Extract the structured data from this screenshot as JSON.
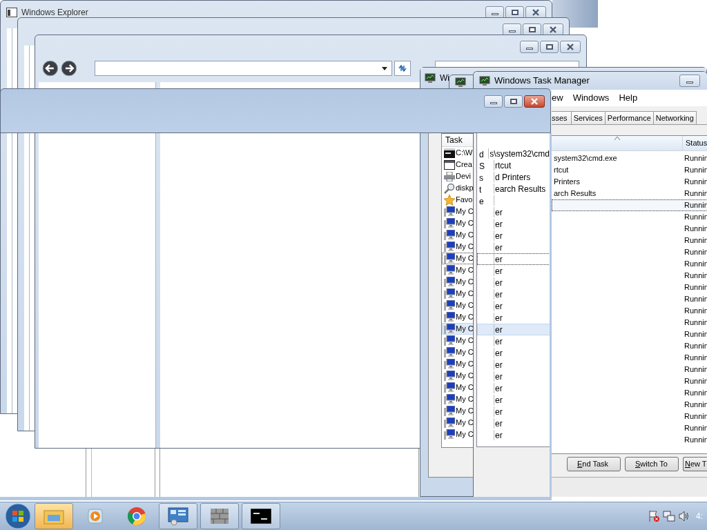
{
  "explorer_windows": [
    {
      "kind": "plain",
      "title": "Windows Explorer"
    },
    {
      "kind": "plain"
    },
    {
      "kind": "browser"
    }
  ],
  "task_manager_back": {
    "title": "Wi",
    "columns": [
      "Task"
    ],
    "rows": [
      {
        "kind": "console",
        "name": "C:\\W",
        "selected": false,
        "focused": false
      },
      {
        "kind": "window",
        "name": "Crea",
        "selected": false,
        "focused": false
      },
      {
        "kind": "printer",
        "name": "Devi",
        "selected": false,
        "focused": false
      },
      {
        "kind": "search",
        "name": "diskp",
        "selected": false,
        "focused": false
      },
      {
        "kind": "star",
        "name": "Favo",
        "selected": false,
        "focused": false
      },
      {
        "kind": "computer",
        "name": "My C",
        "selected": false,
        "focused": false
      },
      {
        "kind": "computer",
        "name": "My C",
        "selected": false,
        "focused": false
      },
      {
        "kind": "computer",
        "name": "My C",
        "selected": false,
        "focused": false
      },
      {
        "kind": "computer",
        "name": "My C",
        "selected": false,
        "focused": false
      },
      {
        "kind": "computer",
        "name": "My C",
        "selected": false,
        "focused": true
      },
      {
        "kind": "computer",
        "name": "My C",
        "selected": false,
        "focused": false
      },
      {
        "kind": "computer",
        "name": "My C",
        "selected": false,
        "focused": false
      },
      {
        "kind": "computer",
        "name": "My C",
        "selected": false,
        "focused": false
      },
      {
        "kind": "computer",
        "name": "My C",
        "selected": false,
        "focused": false
      },
      {
        "kind": "computer",
        "name": "My C",
        "selected": false,
        "focused": false
      },
      {
        "kind": "computer",
        "name": "My C",
        "selected": true,
        "focused": false
      },
      {
        "kind": "computer",
        "name": "My C",
        "selected": false,
        "focused": false
      },
      {
        "kind": "computer",
        "name": "My C",
        "selected": false,
        "focused": false
      },
      {
        "kind": "computer",
        "name": "My C",
        "selected": false,
        "focused": false
      },
      {
        "kind": "computer",
        "name": "My C",
        "selected": false,
        "focused": false
      },
      {
        "kind": "computer",
        "name": "My C",
        "selected": false,
        "focused": false
      },
      {
        "kind": "computer",
        "name": "My C",
        "selected": false,
        "focused": false
      },
      {
        "kind": "computer",
        "name": "My C",
        "selected": false,
        "focused": false
      },
      {
        "kind": "computer",
        "name": "My C",
        "selected": false,
        "focused": false
      },
      {
        "kind": "computer",
        "name": "My C",
        "selected": false,
        "focused": false
      }
    ]
  },
  "stale_list": {
    "rows": [
      {
        "column_1": "d",
        "column_2": "s\\system32\\cmd",
        "selected": false,
        "focused": false
      },
      {
        "column_1": "S",
        "column_2": "rtcut",
        "selected": false,
        "focused": false
      },
      {
        "column_1": "s",
        "column_2": "d Printers",
        "selected": false,
        "focused": false
      },
      {
        "column_1": "t",
        "column_2": "earch Results",
        "selected": false,
        "focused": false
      },
      {
        "column_1": "e",
        "selected": false,
        "focused": false
      },
      {
        "column_2": "er",
        "selected": false,
        "focused": false
      },
      {
        "column_2": "er",
        "selected": false,
        "focused": false
      },
      {
        "column_2": "er",
        "selected": false,
        "focused": false
      },
      {
        "column_2": "er",
        "selected": false,
        "focused": false
      },
      {
        "column_2": "er",
        "selected": false,
        "focused": true
      },
      {
        "column_2": "er",
        "selected": false,
        "focused": false
      },
      {
        "column_2": "er",
        "selected": false,
        "focused": false
      },
      {
        "column_2": "er",
        "selected": false,
        "focused": false
      },
      {
        "column_2": "er",
        "selected": false,
        "focused": false
      },
      {
        "column_2": "er",
        "selected": false,
        "focused": false
      },
      {
        "column_2": "er",
        "selected": true,
        "focused": false
      },
      {
        "column_2": "er",
        "selected": false,
        "focused": false
      },
      {
        "column_2": "er",
        "selected": false,
        "focused": false
      },
      {
        "column_2": "er",
        "selected": false,
        "focused": false
      },
      {
        "column_2": "er",
        "selected": false,
        "focused": false
      },
      {
        "column_2": "er",
        "selected": false,
        "focused": false
      },
      {
        "column_2": "er",
        "selected": false,
        "focused": false
      },
      {
        "column_2": "er",
        "selected": false,
        "focused": false
      },
      {
        "column_2": "er",
        "selected": false,
        "focused": false
      },
      {
        "column_2": "er",
        "selected": false,
        "focused": false
      }
    ]
  },
  "task_manager": {
    "title": "Windows Task Manager",
    "menu": [
      "ew",
      "Windows",
      "Help"
    ],
    "tabs": [
      "sses",
      "Services",
      "Performance",
      "Networking"
    ],
    "columns": [
      "Status"
    ],
    "rows": [
      {
        "name": "system32\\cmd.exe",
        "status": "Runnin",
        "focused": false
      },
      {
        "name": "rtcut",
        "status": "Runnin",
        "focused": false
      },
      {
        "name": "Printers",
        "status": "Runnin",
        "focused": false
      },
      {
        "name": "arch Results",
        "status": "Runnin",
        "focused": false
      },
      {
        "status": "Runnin",
        "focused": true
      },
      {
        "status": "Runnin",
        "focused": false
      },
      {
        "status": "Runnin",
        "focused": false
      },
      {
        "status": "Runnin",
        "focused": false
      },
      {
        "status": "Runnin",
        "focused": false
      },
      {
        "status": "Runnin",
        "focused": false
      },
      {
        "status": "Runnin",
        "focused": false
      },
      {
        "status": "Runnin",
        "focused": false
      },
      {
        "status": "Runnin",
        "focused": false
      },
      {
        "status": "Runnin",
        "focused": false
      },
      {
        "status": "Runnin",
        "focused": false
      },
      {
        "status": "Runnin",
        "focused": false
      },
      {
        "status": "Runnin",
        "focused": false
      },
      {
        "status": "Runnin",
        "focused": false
      },
      {
        "status": "Runnin",
        "focused": false
      },
      {
        "status": "Runnin",
        "focused": false
      },
      {
        "status": "Runnin",
        "focused": false
      },
      {
        "status": "Runnin",
        "focused": false
      },
      {
        "status": "Runnin",
        "focused": false
      },
      {
        "status": "Runnin",
        "focused": false
      },
      {
        "status": "Runnin",
        "focused": false
      }
    ],
    "buttons": [
      "End Task",
      "Switch To",
      "New T"
    ]
  },
  "taskbar": {
    "items": [
      {
        "kind": "explorer",
        "running": true,
        "highlighted": true
      },
      {
        "kind": "media",
        "running": false,
        "highlighted": false
      },
      {
        "kind": "browser",
        "running": false,
        "highlighted": false
      },
      {
        "kind": "control-panel",
        "running": true,
        "highlighted": false
      },
      {
        "kind": "firewall",
        "running": true,
        "highlighted": false
      },
      {
        "kind": "console",
        "running": true,
        "highlighted": false
      }
    ],
    "clock": "4:"
  }
}
